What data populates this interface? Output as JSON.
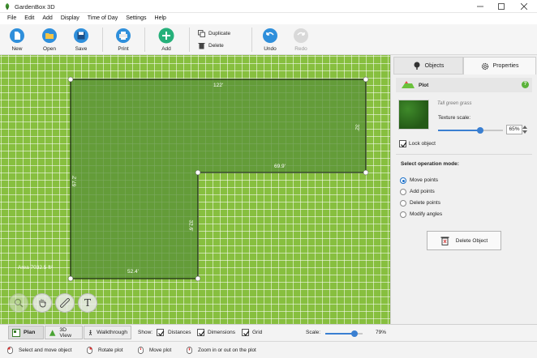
{
  "window": {
    "title": "GardenBox 3D"
  },
  "menu": [
    "File",
    "Edit",
    "Add",
    "Display",
    "Time of Day",
    "Settings",
    "Help"
  ],
  "toolbar": {
    "new": "New",
    "open": "Open",
    "save": "Save",
    "print": "Print",
    "add": "Add",
    "duplicate": "Duplicate",
    "delete": "Delete",
    "undo": "Undo",
    "redo": "Redo"
  },
  "canvas": {
    "dimensions": {
      "top": "122'",
      "right_top": "32'",
      "inner_top": "69.9'",
      "left": "67.2'",
      "inner_right": "32.6'",
      "bottom": "52.4'"
    },
    "area": "Area 7032.5 ft²",
    "tools": [
      "zoom-tool-icon",
      "hand-tool-icon",
      "ruler-tool-icon",
      "text-tool-icon"
    ],
    "tool_text_glyph": "T",
    "colors": {
      "grass": "#87bf3f",
      "plot_fill": "#5a9237",
      "outline": "#1f2e14"
    }
  },
  "panel": {
    "tabs": {
      "objects": "Objects",
      "properties": "Properties"
    },
    "object_name": "Plot",
    "help": "?",
    "texture_name": "Tall green grass",
    "texture_scale_label": "Texture scale:",
    "texture_scale_value": "65%",
    "texture_scale_fraction": 0.65,
    "lock_object": "Lock object",
    "lock_checked": true,
    "operation_mode_title": "Select operation mode:",
    "operation_modes": [
      "Move points",
      "Add points",
      "Delete points",
      "Modify angles"
    ],
    "selected_mode": 0,
    "delete_object": "Delete Object"
  },
  "bottombar": {
    "views": [
      "Plan",
      "3D View",
      "Walkthrough"
    ],
    "active_view": 0,
    "show_label": "Show:",
    "show_options": [
      "Distances",
      "Dimensions",
      "Grid"
    ],
    "scale_label": "Scale:",
    "scale_value": "79%",
    "scale_fraction": 0.79
  },
  "status": [
    "Select and move object",
    "Rotate plot",
    "Move plot",
    "Zoom in or out on the plot"
  ]
}
